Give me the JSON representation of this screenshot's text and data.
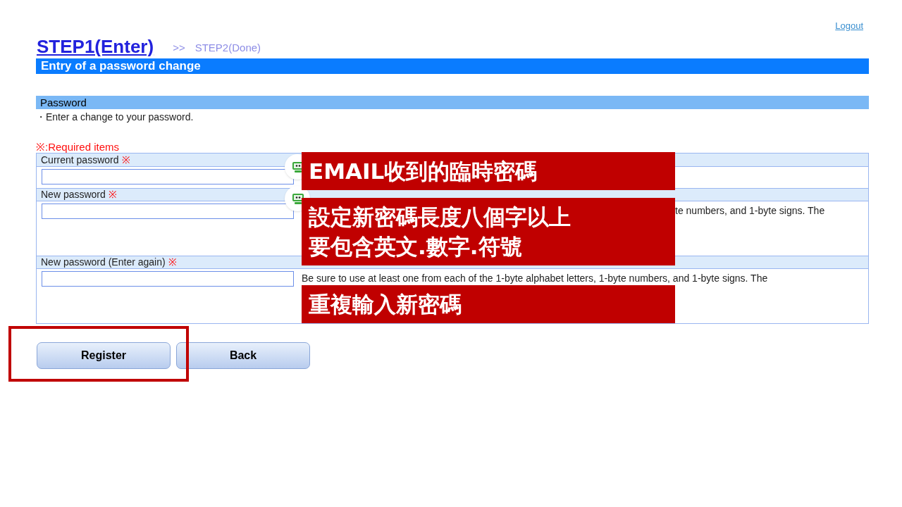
{
  "logout": "Logout",
  "steps": [
    {
      "label": "STEP1(Enter)",
      "selected": true
    },
    {
      "label": "STEP2(Done)",
      "selected": false
    }
  ],
  "step_separator": ">>",
  "title_bar": "Entry of a password change",
  "section": {
    "title": "Password",
    "description": "・Enter a change to your password."
  },
  "required_note": "※:Required items",
  "fields": [
    {
      "label": "Current password",
      "mark": "※"
    },
    {
      "label": "New password",
      "mark": "※",
      "hint": "te numbers, and 1-byte signs. The"
    },
    {
      "label": "New password (Enter again)",
      "mark": "※",
      "hint": "Be sure to use at least one from each of the 1-byte alphabet letters, 1-byte numbers, and 1-byte signs. The"
    }
  ],
  "buttons": [
    {
      "label": "Register",
      "highlighted": true
    },
    {
      "label": "Back",
      "highlighted": false
    }
  ],
  "callouts": [
    {
      "lines": [
        "EMAIL收到的臨時密碼"
      ]
    },
    {
      "lines": [
        "設定新密碼長度八個字以上",
        "要包含英文.數字.符號"
      ]
    },
    {
      "lines": [
        "重複輸入新密碼"
      ]
    }
  ]
}
